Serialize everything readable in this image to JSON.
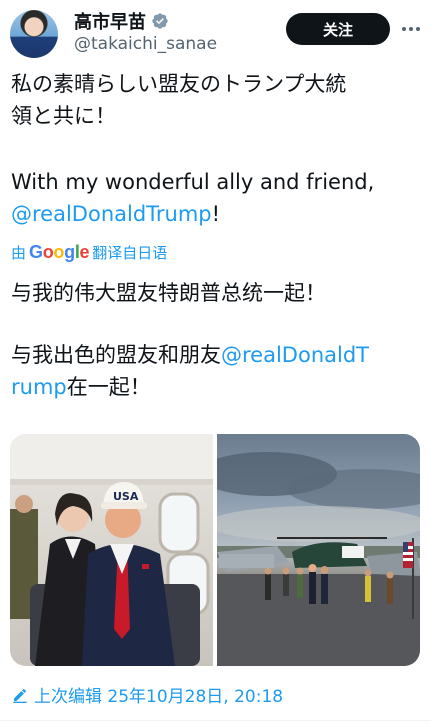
{
  "author": {
    "display_name": "高市早苗",
    "handle": "@takaichi_sanae"
  },
  "follow_label": "关注",
  "post": {
    "jp_line1": "私の素晴らしい盟友のトランプ大統",
    "jp_line2": "領と共に！",
    "en_line1": "With my wonderful ally and friend,",
    "en_mention": "@realDonaldTrump",
    "en_suffix": "!"
  },
  "translation": {
    "prefix": "由",
    "provider": "Google",
    "suffix": "翻译自日语",
    "line1": "与我的伟大盟友特朗普总统一起！",
    "line2_prefix": "与我出色的盟友和朋友",
    "line2_mention_a": "@realDonaldT",
    "line3_mention_b": "rump",
    "line3_suffix": "在一起！"
  },
  "footer": {
    "edited_label": "上次编辑 25年10月28日, 20:18"
  },
  "media": {
    "cap_text": "USA"
  },
  "colors": {
    "accent": "#1d9bf0",
    "text": "#0f1419",
    "secondary": "#536471"
  }
}
